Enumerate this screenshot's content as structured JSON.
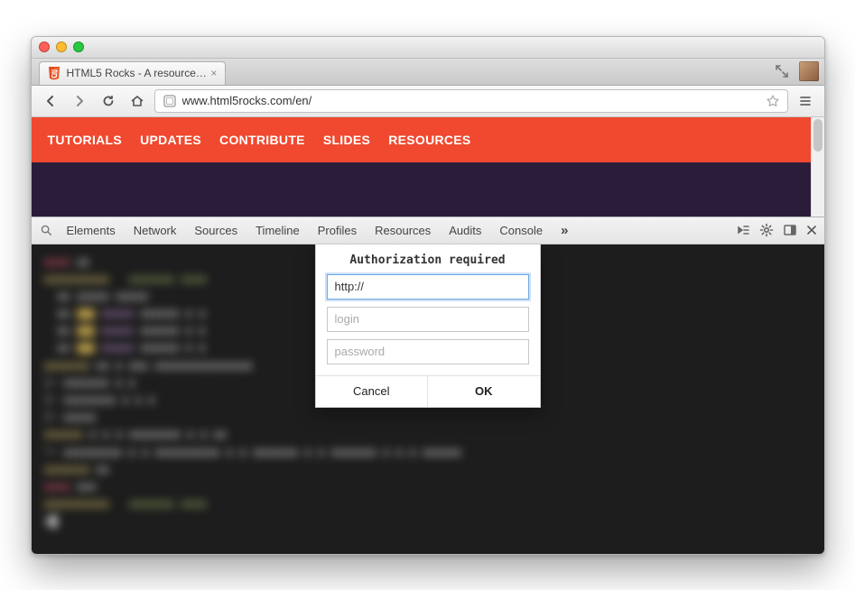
{
  "window": {
    "tab_title": "HTML5 Rocks - A resource…"
  },
  "toolbar": {
    "url": "www.html5rocks.com/en/"
  },
  "nav": {
    "items": [
      "TUTORIALS",
      "UPDATES",
      "CONTRIBUTE",
      "SLIDES",
      "RESOURCES"
    ]
  },
  "devtools": {
    "tabs": [
      "Elements",
      "Network",
      "Sources",
      "Timeline",
      "Profiles",
      "Resources",
      "Audits",
      "Console"
    ],
    "more": "»"
  },
  "modal": {
    "title": "Authorization required",
    "url_value": "http://",
    "login_placeholder": "login",
    "password_placeholder": "password",
    "cancel": "Cancel",
    "ok": "OK"
  }
}
